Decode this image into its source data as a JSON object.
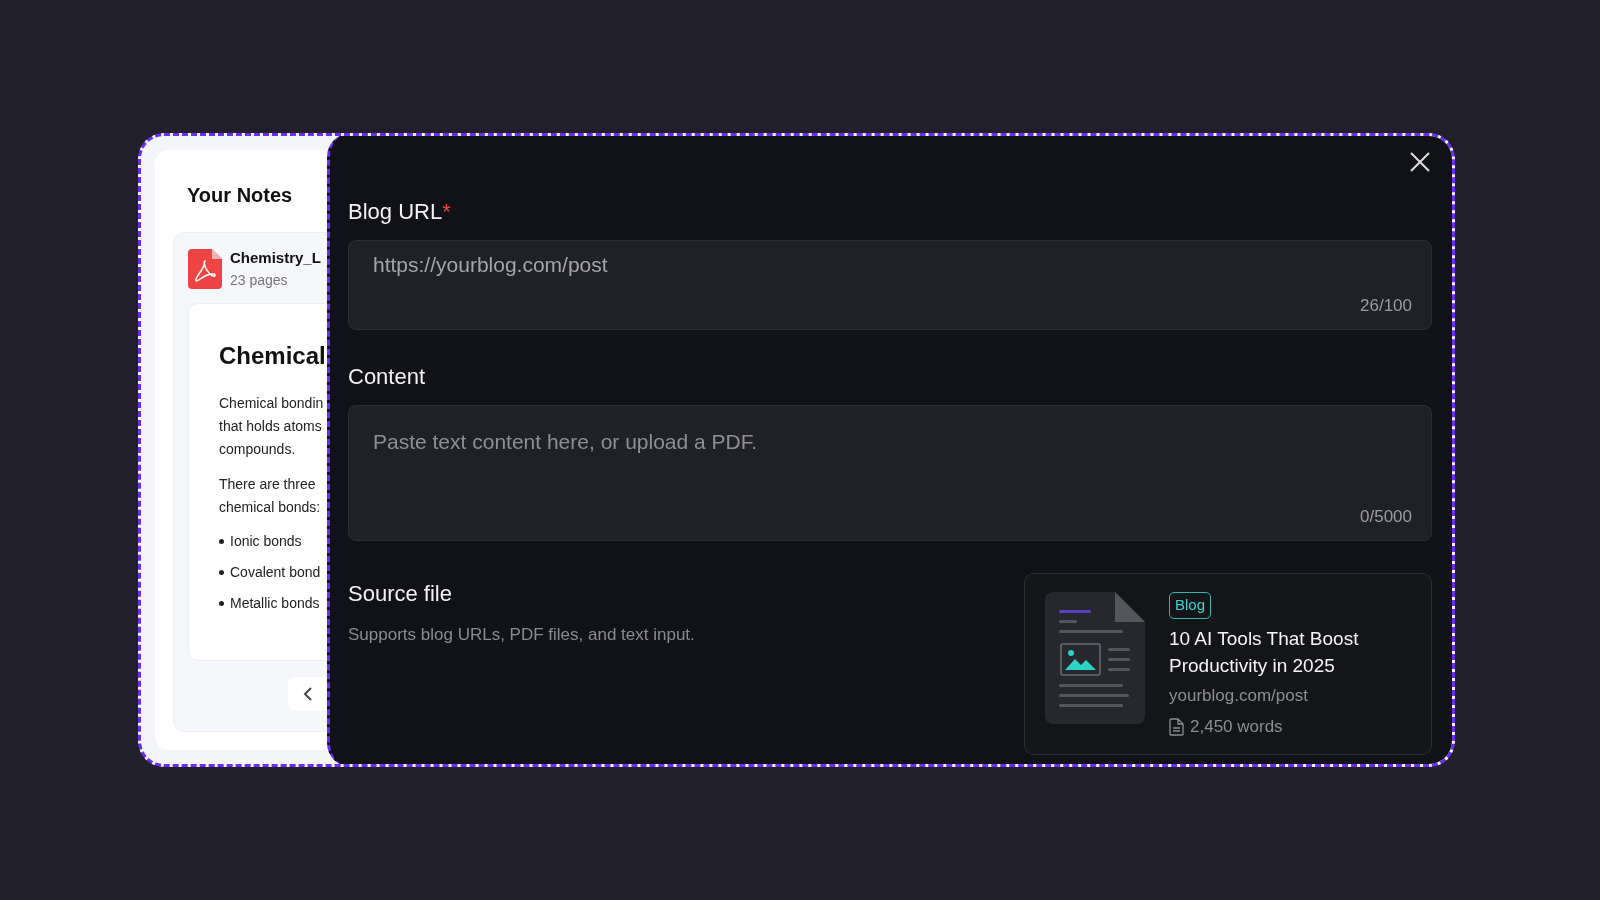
{
  "notes_panel": {
    "title": "Your Notes",
    "file": {
      "name": "Chemistry_L",
      "pages": "23 pages"
    },
    "preview": {
      "heading": "Chemical",
      "paragraphs": [
        [
          "Chemical bondin",
          "that holds atoms",
          "compounds."
        ],
        [
          "There are three",
          "chemical bonds:"
        ]
      ],
      "bullets": [
        "Ionic bonds",
        "Covalent bond",
        "Metallic bonds"
      ]
    }
  },
  "modal": {
    "fields": [
      {
        "kind": "input",
        "label": "Blog URL",
        "required_mark": "*",
        "value": "https://yourblog.com/post",
        "counter": "26/100"
      },
      {
        "kind": "textarea",
        "label": "Content",
        "placeholder": "Paste text content here, or upload a PDF.",
        "counter": "0/5000"
      }
    ],
    "source": {
      "title": "Source file",
      "subtitle": "Supports blog URLs, PDF files, and text input.",
      "card": {
        "tag": "Blog",
        "title": "10 AI Tools That Boost Productivity in 2025",
        "url": "yourblog.com/post",
        "words": "2,450 words"
      }
    }
  }
}
